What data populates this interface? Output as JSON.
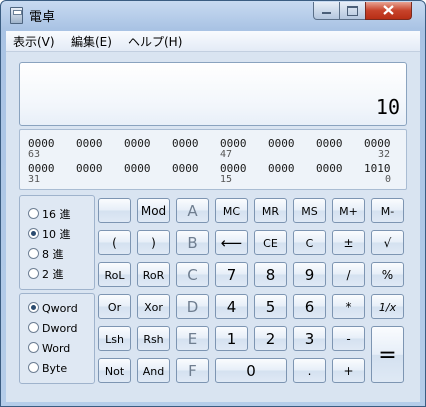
{
  "window": {
    "title": "電卓"
  },
  "menu": [
    {
      "label": "表示(V)"
    },
    {
      "label": "編集(E)"
    },
    {
      "label": "ヘルプ(H)"
    }
  ],
  "display": {
    "value": "10"
  },
  "bits": {
    "row1": [
      "0000",
      "0000",
      "0000",
      "0000",
      "0000",
      "0000",
      "0000",
      "0000"
    ],
    "row1_idx": [
      "63",
      "47",
      "32"
    ],
    "row2": [
      "0000",
      "0000",
      "0000",
      "0000",
      "0000",
      "0000",
      "0000",
      "1010"
    ],
    "row2_idx": [
      "31",
      "15",
      "0"
    ]
  },
  "base": {
    "options": [
      {
        "label": "16 進",
        "selected": false
      },
      {
        "label": "10 進",
        "selected": true
      },
      {
        "label": "8 進",
        "selected": false
      },
      {
        "label": "2 進",
        "selected": false
      }
    ]
  },
  "word": {
    "options": [
      {
        "label": "Qword",
        "selected": true
      },
      {
        "label": "Dword",
        "selected": false
      },
      {
        "label": "Word",
        "selected": false
      },
      {
        "label": "Byte",
        "selected": false
      }
    ]
  },
  "keys": {
    "blank": "",
    "mod": "Mod",
    "a": "A",
    "mc": "MC",
    "mr": "MR",
    "ms": "MS",
    "mplus": "M+",
    "mminus": "M-",
    "lparen": "(",
    "rparen": ")",
    "b": "B",
    "backspace": "⟵",
    "ce": "CE",
    "c": "C",
    "plusminus": "±",
    "sqrt": "√",
    "rol": "RoL",
    "ror": "RoR",
    "hc": "C",
    "n7": "7",
    "n8": "8",
    "n9": "9",
    "div": "/",
    "pct": "%",
    "or": "Or",
    "xor": "Xor",
    "d": "D",
    "n4": "4",
    "n5": "5",
    "n6": "6",
    "mul": "*",
    "recip": "1/x",
    "lsh": "Lsh",
    "rsh": "Rsh",
    "e": "E",
    "n1": "1",
    "n2": "2",
    "n3": "3",
    "sub": "-",
    "eq": "=",
    "not": "Not",
    "and": "And",
    "f": "F",
    "n0": "0",
    "dot": ".",
    "add": "+"
  }
}
